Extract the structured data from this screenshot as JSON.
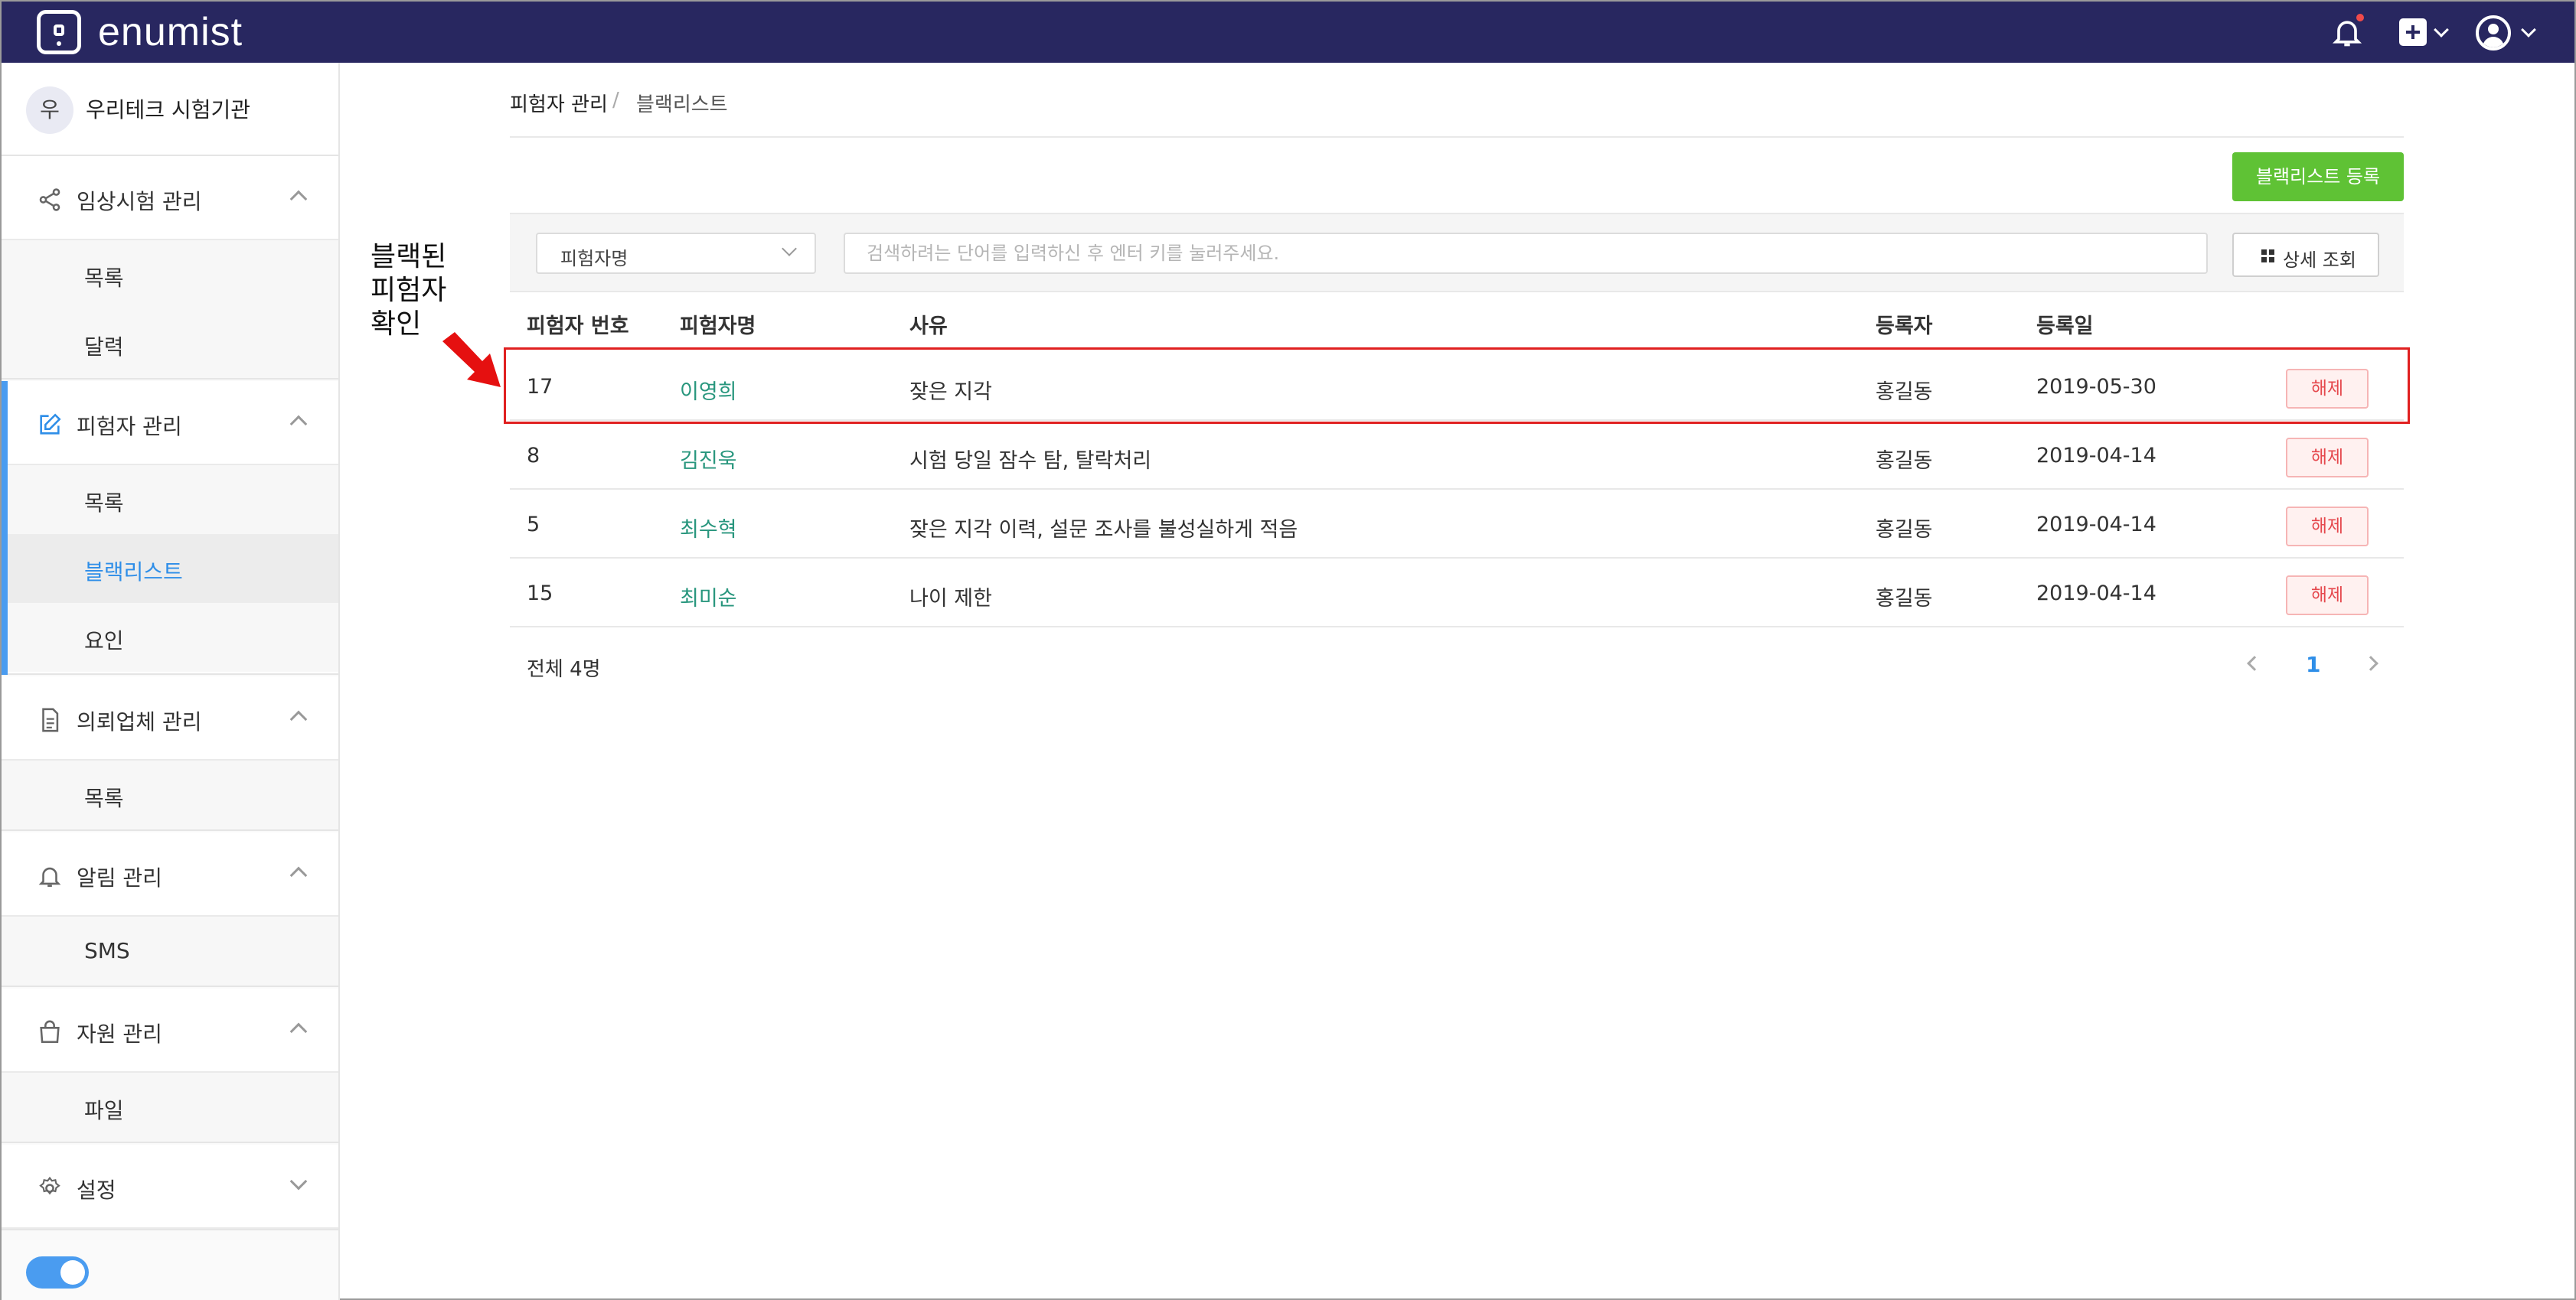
{
  "app": {
    "brand": "enumist"
  },
  "topbar": {
    "bell_icon": "bell-icon",
    "add_icon": "plus-square-icon",
    "user_icon": "user-circle-icon"
  },
  "sidebar": {
    "org": {
      "initial": "우",
      "name": "우리테크 시험기관"
    },
    "groups": [
      {
        "label": "임상시험 관리",
        "icon": "share-icon",
        "items": [
          "목록",
          "달력"
        ]
      },
      {
        "label": "피험자 관리",
        "icon": "edit-icon",
        "items": [
          "목록",
          "블랙리스트",
          "요인"
        ]
      },
      {
        "label": "의뢰업체 관리",
        "icon": "document-icon",
        "items": [
          "목록"
        ]
      },
      {
        "label": "알림 관리",
        "icon": "bell-icon",
        "items": [
          "SMS"
        ]
      },
      {
        "label": "자원 관리",
        "icon": "bag-icon",
        "items": [
          "파일"
        ]
      },
      {
        "label": "설정",
        "icon": "gear-icon",
        "items": []
      }
    ],
    "active_item": "블랙리스트"
  },
  "breadcrumb": {
    "parent": "피험자 관리",
    "separator": "/",
    "current": "블랙리스트"
  },
  "actions": {
    "register_label": "블랙리스트 등록"
  },
  "filter": {
    "select_value": "피험자명",
    "search_placeholder": "검색하려는 단어를 입력하신 후 엔터 키를 눌러주세요.",
    "detail_label": "상세 조회"
  },
  "table": {
    "headers": [
      "피험자 번호",
      "피험자명",
      "사유",
      "등록자",
      "등록일"
    ],
    "rows": [
      {
        "no": "17",
        "name": "이영희",
        "reason": "잦은 지각",
        "registrar": "홍길동",
        "date": "2019-05-30",
        "action": "해제"
      },
      {
        "no": "8",
        "name": "김진욱",
        "reason": "시험 당일 잠수 탐, 탈락처리",
        "registrar": "홍길동",
        "date": "2019-04-14",
        "action": "해제"
      },
      {
        "no": "5",
        "name": "최수혁",
        "reason": "잦은 지각 이력, 설문 조사를 불성실하게 적음",
        "registrar": "홍길동",
        "date": "2019-04-14",
        "action": "해제"
      },
      {
        "no": "15",
        "name": "최미순",
        "reason": "나이 제한",
        "registrar": "홍길동",
        "date": "2019-04-14",
        "action": "해제"
      }
    ]
  },
  "footer": {
    "total": "전체 4명",
    "current_page": "1"
  },
  "annotation": {
    "line1": "블랙된",
    "line2": "피험자",
    "line3": "확인"
  },
  "colors": {
    "topbar": "#282760",
    "accent": "#4a9cf0",
    "green": "#5fc235",
    "name_link": "#28967d",
    "danger": "#e5484d"
  }
}
